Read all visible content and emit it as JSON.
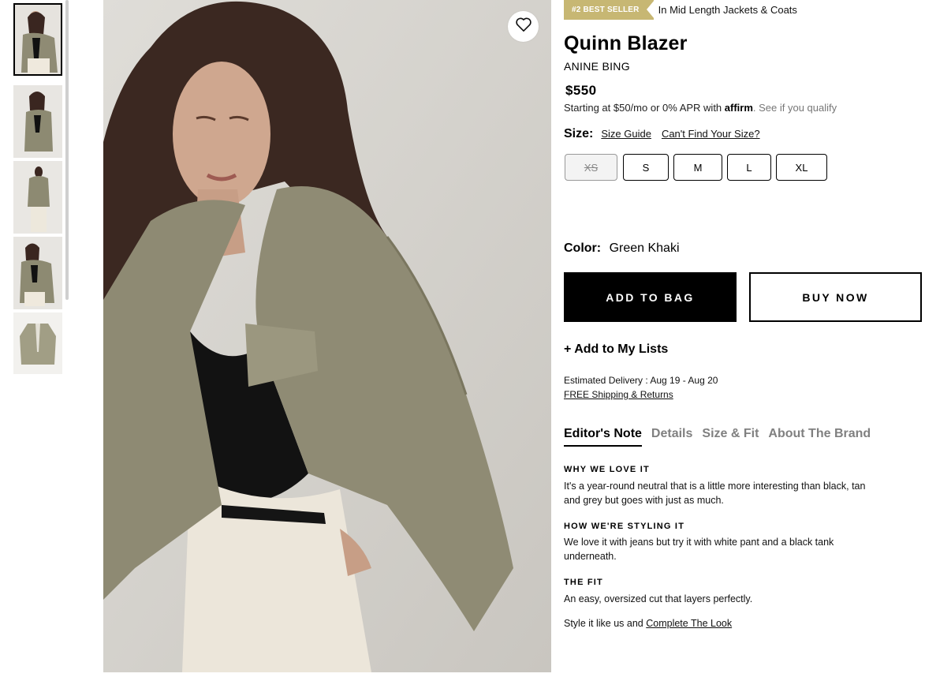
{
  "badge": {
    "rank": "#2 BEST SELLER",
    "category": "In Mid Length Jackets & Coats",
    "color": "#c7b773"
  },
  "product": {
    "title": "Quinn Blazer",
    "brand": "ANINE BING",
    "price": "$550",
    "financing": {
      "text": "Starting at $50/mo or 0% APR with",
      "logo": "affirm",
      "qualify": ". See if you qualify"
    }
  },
  "size": {
    "label": "Size:",
    "guide_link": "Size Guide",
    "cant_find_link": "Can't Find Your Size?",
    "options": [
      {
        "label": "XS",
        "available": false
      },
      {
        "label": "S",
        "available": true
      },
      {
        "label": "M",
        "available": true
      },
      {
        "label": "L",
        "available": true
      },
      {
        "label": "XL",
        "available": true
      }
    ]
  },
  "color": {
    "label": "Color:",
    "value": "Green Khaki"
  },
  "actions": {
    "add_to_bag": "ADD TO BAG",
    "buy_now": "BUY NOW",
    "add_to_lists": "+ Add to My Lists"
  },
  "delivery": {
    "estimate": "Estimated Delivery : Aug 19 - Aug 20",
    "shipping": "FREE Shipping & Returns"
  },
  "tabs": [
    {
      "label": "Editor's Note",
      "active": true
    },
    {
      "label": "Details",
      "active": false
    },
    {
      "label": "Size & Fit",
      "active": false
    },
    {
      "label": "About The Brand",
      "active": false
    }
  ],
  "editor_note": {
    "sections": [
      {
        "heading": "WHY WE LOVE IT",
        "body": "It's a year-round neutral that is a little more interesting than black, tan and grey but goes with just as much."
      },
      {
        "heading": "HOW WE'RE STYLING IT",
        "body": "We love it with jeans but try it with white pant and a black tank underneath."
      },
      {
        "heading": "THE FIT",
        "body": "An easy, oversized cut that layers perfectly."
      }
    ],
    "style_prefix": "Style it like us and",
    "style_link": "Complete The Look"
  },
  "icons": {
    "wishlist": "heart-icon"
  }
}
